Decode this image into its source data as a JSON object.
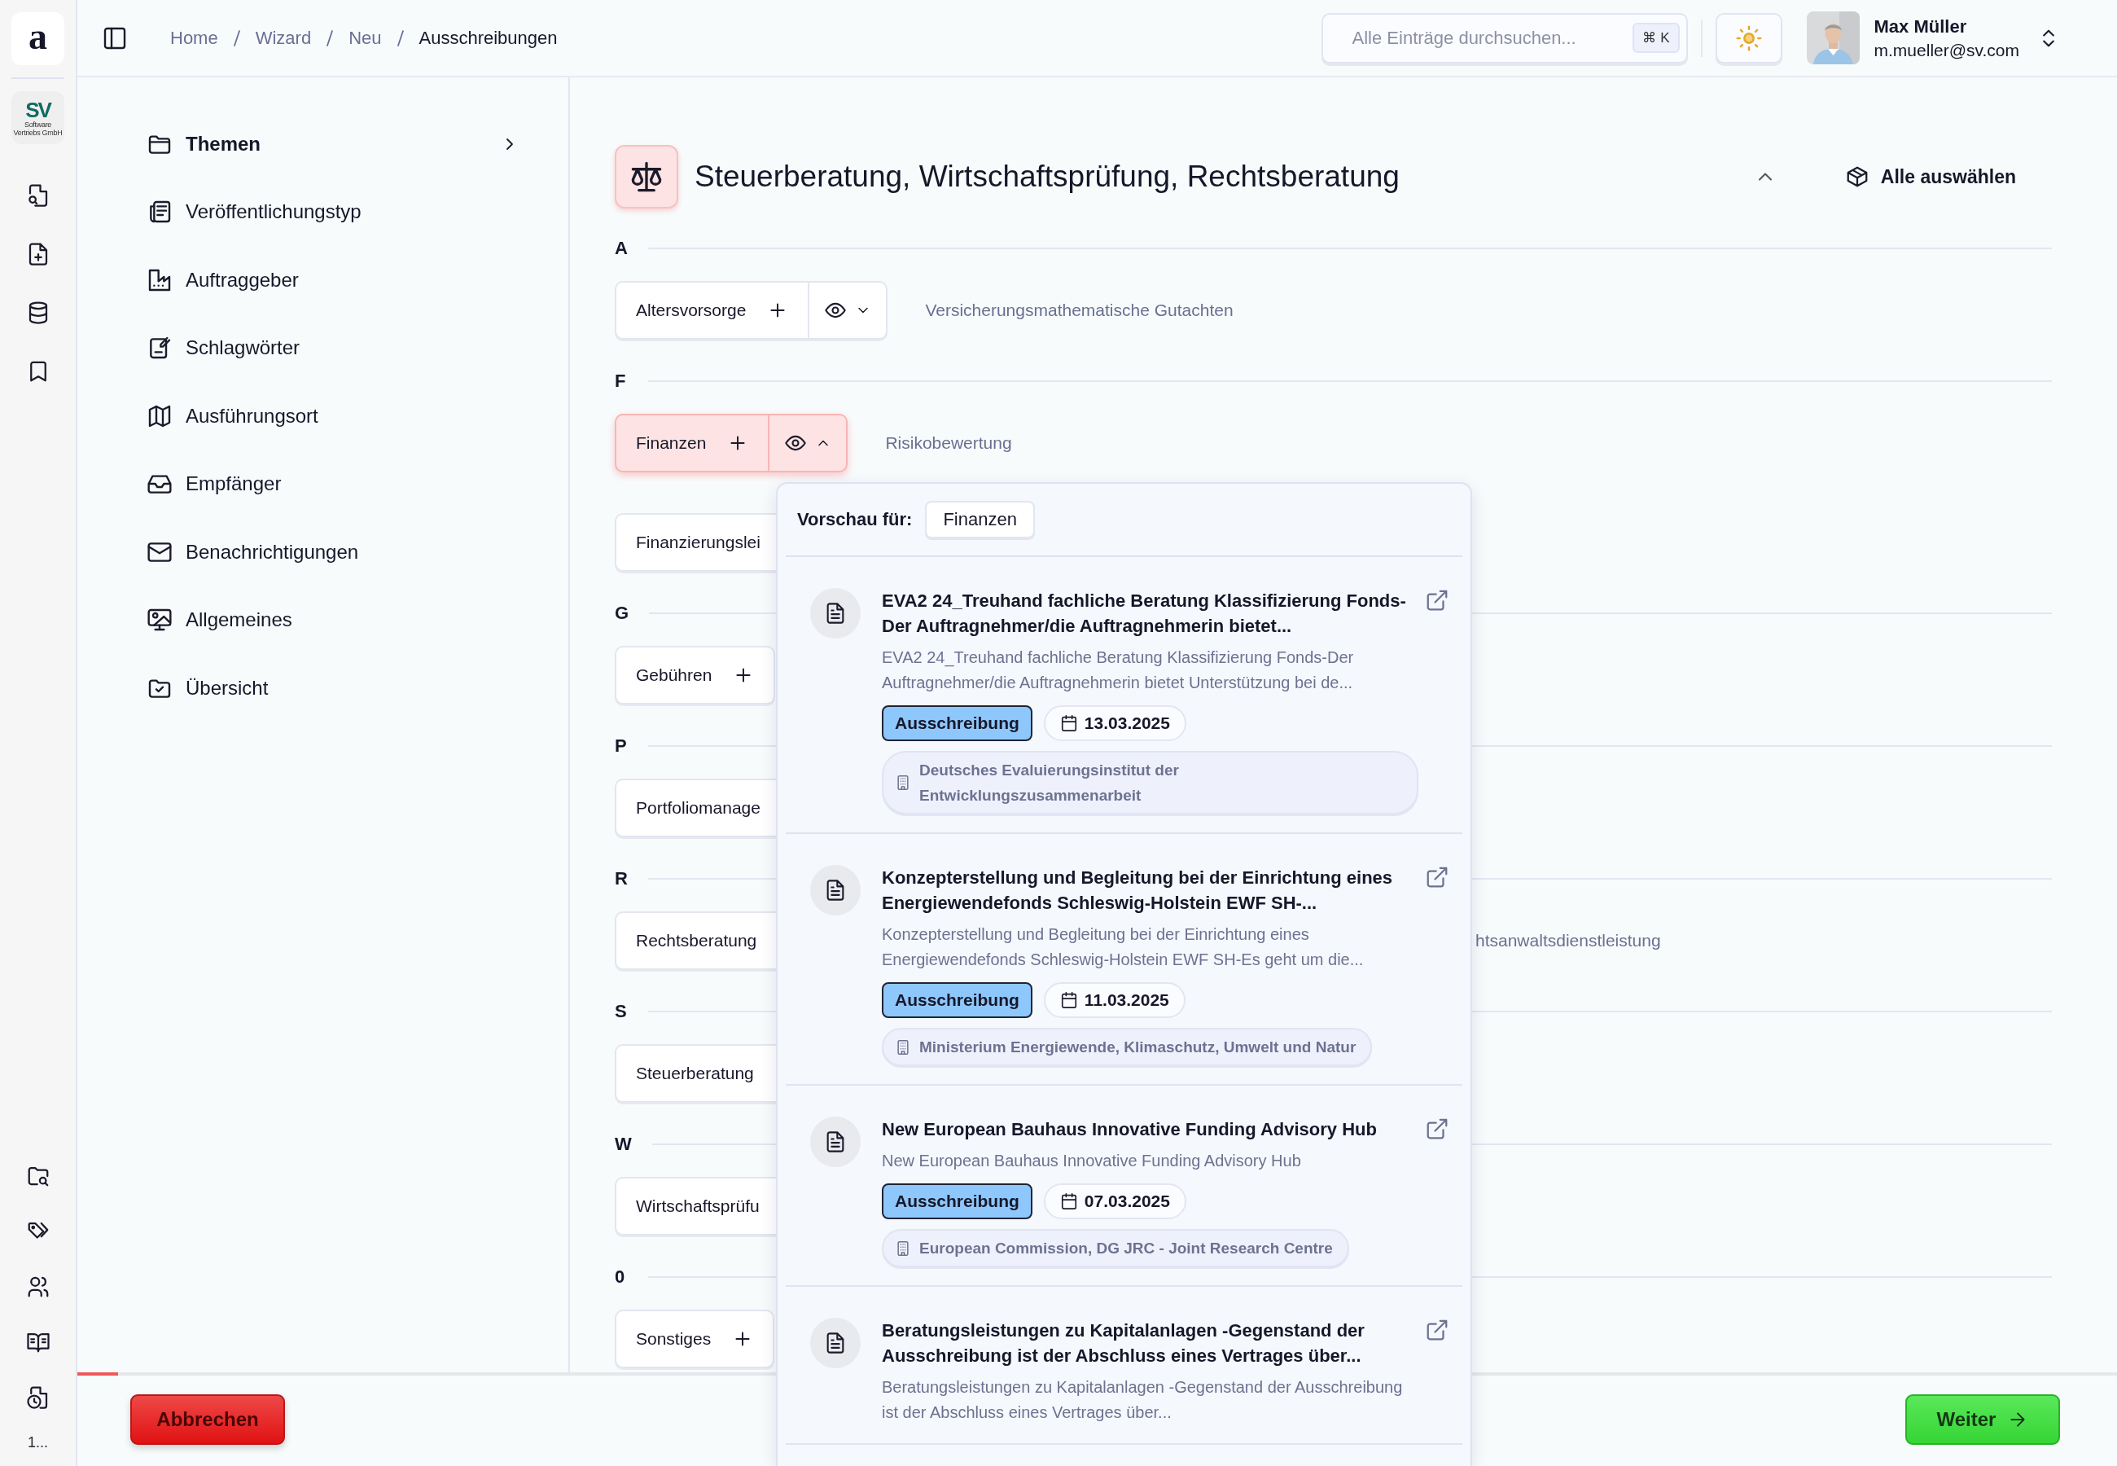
{
  "rail": {
    "logo": "a",
    "brand": {
      "initials": "SV",
      "lines": [
        "Software",
        "Vertriebs GmbH"
      ]
    },
    "footer": "1..."
  },
  "breadcrumb": [
    {
      "label": "Home",
      "current": false
    },
    {
      "label": "Wizard",
      "current": false
    },
    {
      "label": "Neu",
      "current": false
    },
    {
      "label": "Ausschreibungen",
      "current": true
    }
  ],
  "search": {
    "placeholder": "Alle Einträge durchsuchen...",
    "shortcut": "⌘ K"
  },
  "user": {
    "name": "Max Müller",
    "email": "m.mueller@sv.com"
  },
  "nav": [
    {
      "label": "Themen",
      "selected": true
    },
    {
      "label": "Veröffentlichungstyp",
      "selected": false
    },
    {
      "label": "Auftraggeber",
      "selected": false
    },
    {
      "label": "Schlagwörter",
      "selected": false
    },
    {
      "label": "Ausführungsort",
      "selected": false
    },
    {
      "label": "Empfänger",
      "selected": false
    },
    {
      "label": "Benachrichtigungen",
      "selected": false
    },
    {
      "label": "Allgemeines",
      "selected": false
    },
    {
      "label": "Übersicht",
      "selected": false
    }
  ],
  "section": {
    "title": "Steuerberatung, Wirtschaftsprüfung, Rechtsberatung",
    "expanded": true,
    "select_all": "Alle auswählen"
  },
  "groups": [
    {
      "letter": "A",
      "topics": [
        {
          "label": "Altersvorsorge",
          "selected": false,
          "add_button": true,
          "preview": {
            "expanded": false
          },
          "note": "Versicherungsmathematische Gutachten"
        }
      ]
    },
    {
      "letter": "F",
      "topics": [
        {
          "label": "Finanzen",
          "selected": true,
          "add_button": true,
          "preview": {
            "expanded": true
          },
          "note": "Risikobewertung"
        },
        {
          "label": "Finanzierungslei",
          "selected": false,
          "add_button": false
        }
      ]
    },
    {
      "letter": "G",
      "topics": [
        {
          "label": "Gebühren",
          "selected": false,
          "add_button": true
        }
      ]
    },
    {
      "letter": "P",
      "topics": [
        {
          "label": "Portfoliomanage",
          "selected": false,
          "add_button": false
        }
      ]
    },
    {
      "letter": "R",
      "topics": [
        {
          "label": "Rechtsberatung",
          "selected": false,
          "add_button": false,
          "trailing_text": "htsanwaltsdienstleistung"
        }
      ]
    },
    {
      "letter": "S",
      "topics": [
        {
          "label": "Steuerberatung",
          "selected": false,
          "add_button": false
        }
      ]
    },
    {
      "letter": "W",
      "topics": [
        {
          "label": "Wirtschaftsprüfu",
          "selected": false,
          "add_button": false
        }
      ]
    },
    {
      "letter": "0",
      "topics": [
        {
          "label": "Sonstiges",
          "selected": false,
          "add_button": true
        }
      ]
    }
  ],
  "preview": {
    "label": "Vorschau für:",
    "topic": "Finanzen",
    "items": [
      {
        "title": "EVA2 24_Treuhand fachliche Beratung Klassifizierung Fonds-Der Auftragnehmer/die Auftragnehmerin bietet...",
        "description": "EVA2 24_Treuhand fachliche Beratung Klassifizierung Fonds-Der Auftragnehmer/die Auftragnehmerin bietet Unterstützung bei de...",
        "type": "Ausschreibung",
        "date": "13.03.2025",
        "organization": "Deutsches Evaluierungsinstitut der Entwicklungszusammenarbeit"
      },
      {
        "title": "Konzepterstellung und Begleitung bei der Einrichtung eines Energiewendefonds Schleswig-Holstein EWF SH-...",
        "description": "Konzepterstellung und Begleitung bei der Einrichtung eines Energiewendefonds Schleswig-Holstein EWF SH-Es geht um die...",
        "type": "Ausschreibung",
        "date": "11.03.2025",
        "organization": "Ministerium Energiewende, Klimaschutz, Umwelt und Natur"
      },
      {
        "title": "New European Bauhaus Innovative Funding Advisory Hub",
        "description": "New European Bauhaus Innovative Funding Advisory Hub",
        "type": "Ausschreibung",
        "date": "07.03.2025",
        "organization": "European Commission, DG JRC - Joint Research Centre"
      },
      {
        "title": "Beratungsleistungen zu Kapitalanlagen -Gegenstand der Ausschreibung ist der Abschluss eines Vertrages über...",
        "description": "Beratungsleistungen zu Kapitalanlagen -Gegenstand der Ausschreibung ist der Abschluss eines Vertrages über..."
      }
    ]
  },
  "footer": {
    "progress": {
      "level": 0.02
    },
    "cancel": "Abbrechen",
    "next": "Weiter"
  }
}
